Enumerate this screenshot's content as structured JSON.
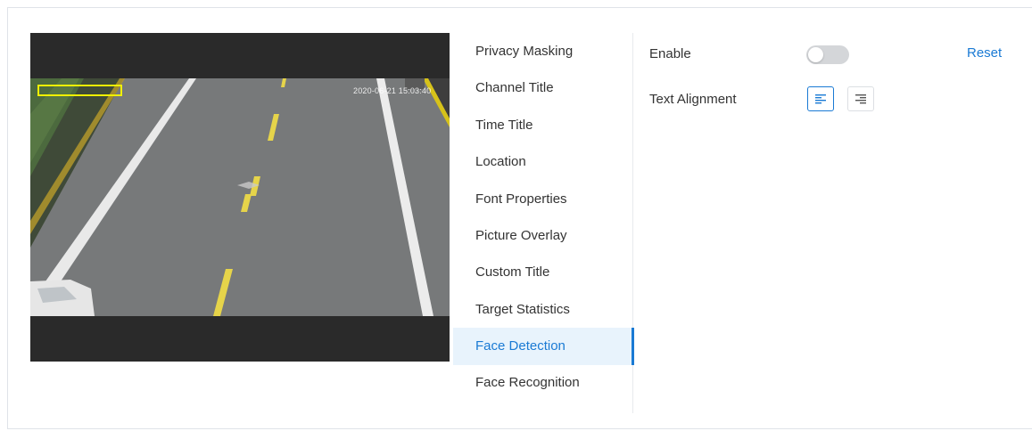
{
  "video": {
    "timestamp": "2020-06-21 15:03:40"
  },
  "tabs": [
    {
      "label": "Privacy Masking",
      "active": false
    },
    {
      "label": "Channel Title",
      "active": false
    },
    {
      "label": "Time Title",
      "active": false
    },
    {
      "label": "Location",
      "active": false
    },
    {
      "label": "Font Properties",
      "active": false
    },
    {
      "label": "Picture Overlay",
      "active": false
    },
    {
      "label": "Custom Title",
      "active": false
    },
    {
      "label": "Target Statistics",
      "active": false
    },
    {
      "label": "Face Detection",
      "active": true
    },
    {
      "label": "Face Recognition",
      "active": false
    }
  ],
  "settings": {
    "enable_label": "Enable",
    "enable_on": false,
    "reset_label": "Reset",
    "alignment_label": "Text Alignment",
    "alignment_selected": "left",
    "align_left_icon": "align-left-icon",
    "align_right_icon": "align-right-icon"
  },
  "colors": {
    "accent": "#1a7ad4",
    "active_tab_bg": "#e8f3fc",
    "toggle_off": "#d4d6d9",
    "osd_box": "#f0f000"
  }
}
